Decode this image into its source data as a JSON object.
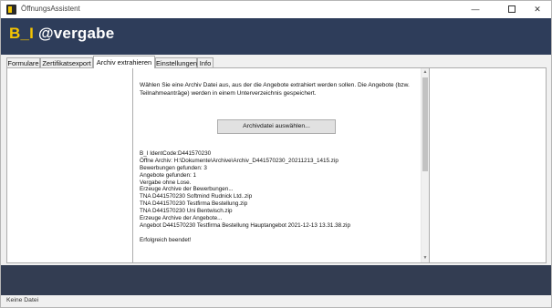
{
  "window": {
    "title": "ÖffnungsAssistent",
    "minimize_glyph": "—",
    "close_glyph": "✕"
  },
  "banner": {
    "logo_prefix": "B_I",
    "logo_suffix": "@vergabe",
    "background_color": "#2e3d5a",
    "accent_color": "#f5c400"
  },
  "tabs": [
    {
      "label": "Formulare"
    },
    {
      "label": "Zertifikatsexport"
    },
    {
      "label": "Archiv extrahieren",
      "active": true
    },
    {
      "label": "Einstellungen"
    },
    {
      "label": "Info"
    }
  ],
  "archive": {
    "intro": "Wählen Sie eine Archiv Datei aus, aus der die Angebote extrahiert werden sollen. Die Angebote (bzw. Teilnahmeanträge) werden in einem Unterverzeichnis gespeichert.",
    "select_button": "Archivdatei auswählen...",
    "log": [
      "B_I IdentCode:D441570230",
      "Öffne Archiv: H:\\Dokumente\\Archive\\Archiv_D441570230_20211213_1415.zip",
      "Bewerbungen gefunden: 3",
      "Angebote gefunden: 1",
      "Vergabe ohne Lose.",
      "Erzeuge Archive der Bewerbungen...",
      "TNA D441570230 Softmind Rudnick Ltd..zip",
      "TNA D441570230 Testfirma Bestellung.zip",
      "TNA D441570230 Uni Bentwisch.zip",
      "Erzeuge Archive der Angebote...",
      "Angebot D441570230 Testfirma Bestellung Hauptangebot 2021-12-13 13.31.38.zip",
      "",
      "Erfolgreich beendet!"
    ]
  },
  "scrollbar": {
    "up_glyph": "▲",
    "down_glyph": "▼"
  },
  "status": {
    "text": "Keine Datei"
  }
}
